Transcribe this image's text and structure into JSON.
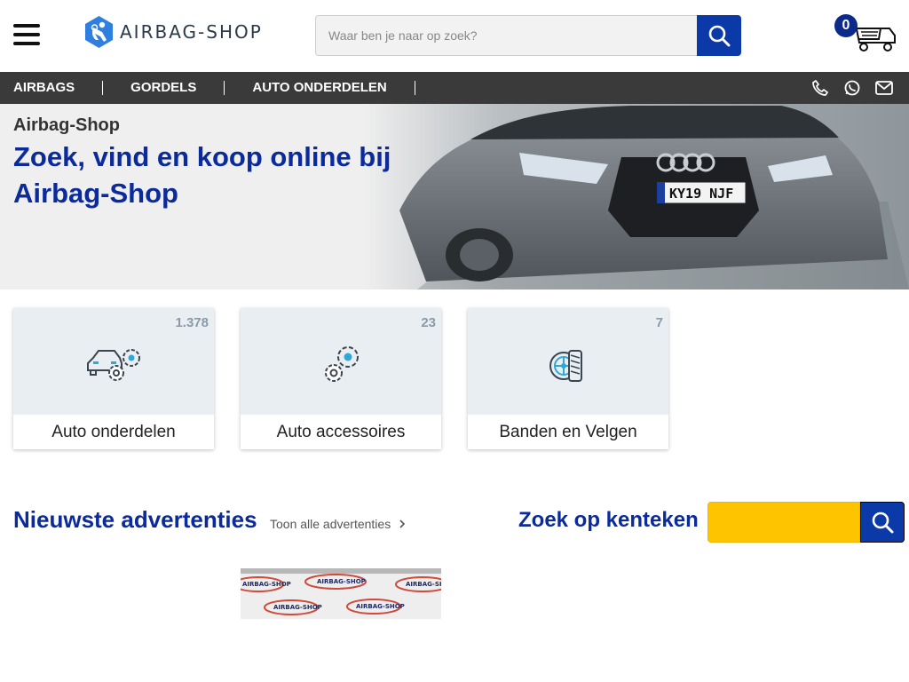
{
  "brand": {
    "logo_text": "AIRBAG-SHOP",
    "accent": "#0b2a9c",
    "button_blue": "#0b3aa8",
    "plate_yellow": "#ffc400"
  },
  "search": {
    "placeholder": "Waar ben je naar op zoek?"
  },
  "cart": {
    "count": "0"
  },
  "nav": {
    "items": [
      "AIRBAGS",
      "GORDELS",
      "AUTO ONDERDELEN"
    ],
    "icons": [
      "phone-icon",
      "whatsapp-icon",
      "mail-icon"
    ]
  },
  "hero": {
    "subtitle": "Airbag-Shop",
    "title": "Zoek, vind en koop online bij Airbag-Shop",
    "plate_text": "KY19 NJF"
  },
  "categories": [
    {
      "label": "Auto onderdelen",
      "count": "1.378",
      "icon": "car-gears-icon"
    },
    {
      "label": "Auto accessoires",
      "count": "23",
      "icon": "gears-icon"
    },
    {
      "label": "Banden en Velgen",
      "count": "7",
      "icon": "wheel-tire-icon"
    }
  ],
  "newest": {
    "title": "Nieuwste advertenties",
    "link": "Toon alle advertenties"
  },
  "plate_search": {
    "title": "Zoek op kenteken"
  },
  "ad_watermark": "AIRBAG-SHOP"
}
